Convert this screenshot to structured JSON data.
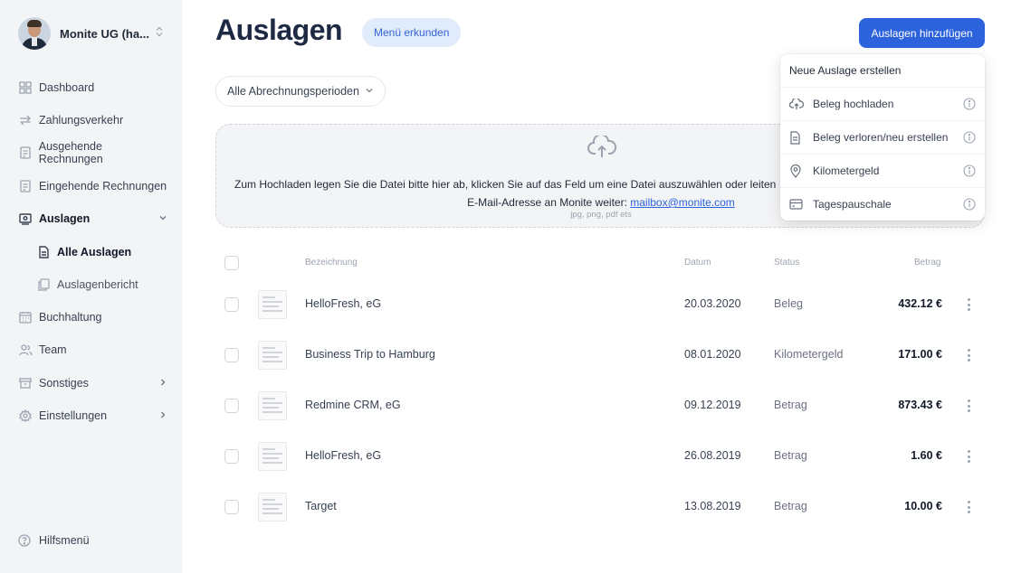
{
  "sidebar": {
    "org_name": "Monite UG (ha...",
    "items": [
      {
        "label": "Dashboard",
        "icon": "grid-icon"
      },
      {
        "label": "Zahlungsverkehr",
        "icon": "transfer-icon"
      },
      {
        "label": "Ausgehende Rechnungen",
        "icon": "invoice-out-icon"
      },
      {
        "label": "Eingehende Rechnungen",
        "icon": "invoice-in-icon"
      },
      {
        "label": "Auslagen",
        "icon": "receipt-icon"
      },
      {
        "label": "Buchhaltung",
        "icon": "calendar-icon"
      },
      {
        "label": "Team",
        "icon": "team-icon"
      },
      {
        "label": "Sonstiges",
        "icon": "archive-icon"
      },
      {
        "label": "Einstellungen",
        "icon": "gear-icon"
      }
    ],
    "sub_items": [
      {
        "label": "Alle Auslagen",
        "icon": "document-icon"
      },
      {
        "label": "Auslagenbericht",
        "icon": "copy-icon"
      }
    ],
    "help_label": "Hilfsmenü"
  },
  "header": {
    "title": "Auslagen",
    "tour_label": "Menü erkunden",
    "add_label": "Auslagen hinzufügen"
  },
  "filters": {
    "period_label": "Alle Abrechnungsperioden"
  },
  "upload": {
    "line1": "Zum Hochladen legen Sie die Datei bitte hier ab, klicken Sie auf das Feld um eine Datei auszuwählen oder leiten",
    "line2": "E-Mail-Adresse an Monite weiter:",
    "email": "mailbox@monite.com",
    "hint": "jpg, png, pdf ets"
  },
  "table": {
    "headers": {
      "name": "Bezeichnung",
      "date": "Datum",
      "status": "Status",
      "amount": "Betrag"
    },
    "rows": [
      {
        "name": "HelloFresh, eG",
        "date": "20.03.2020",
        "status": "Beleg",
        "amount": "432.12 €"
      },
      {
        "name": "Business Trip to Hamburg",
        "date": "08.01.2020",
        "status": "Kilometergeld",
        "amount": "171.00 €"
      },
      {
        "name": "Redmine CRM, eG",
        "date": "09.12.2019",
        "status": "Betrag",
        "amount": "873.43 €"
      },
      {
        "name": "HelloFresh, eG",
        "date": "26.08.2019",
        "status": "Betrag",
        "amount": "1.60 €"
      },
      {
        "name": "Target",
        "date": "13.08.2019",
        "status": "Betrag",
        "amount": "10.00 €"
      }
    ]
  },
  "menu": {
    "title": "Neue Auslage erstellen",
    "items": [
      {
        "label": "Beleg hochladen",
        "icon": "cloud-upload-icon"
      },
      {
        "label": "Beleg verloren/neu erstellen",
        "icon": "document-icon"
      },
      {
        "label": "Kilometergeld",
        "icon": "location-pin-icon"
      },
      {
        "label": "Tagespauschale",
        "icon": "card-icon"
      }
    ]
  },
  "colors": {
    "accent": "#2c63dd",
    "sidebar_bg": "#f3f4f6",
    "title": "#1e2a44"
  }
}
